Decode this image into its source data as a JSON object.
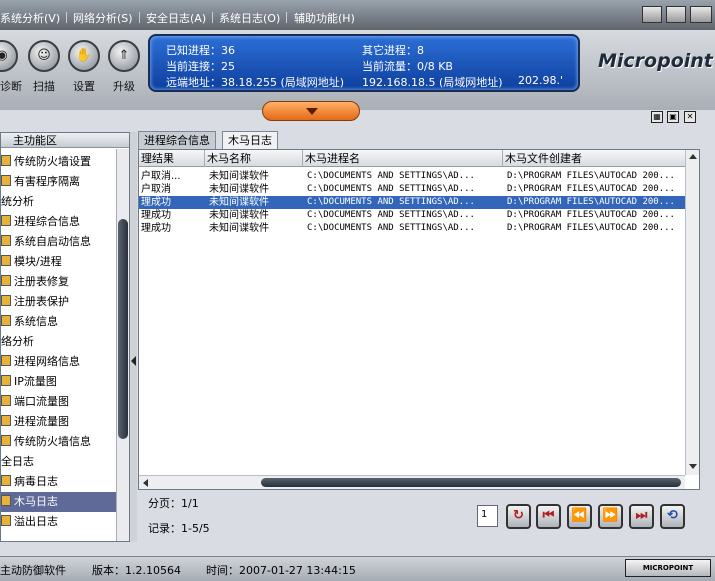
{
  "menu": [
    "系统分析(V)",
    "网络分析(S)",
    "安全日志(A)",
    "系统日志(O)",
    "辅助功能(H)"
  ],
  "toolbar": {
    "buttons": [
      {
        "label": "诊断",
        "icon": "diagnose-icon"
      },
      {
        "label": "扫描",
        "icon": "scan-icon"
      },
      {
        "label": "设置",
        "icon": "settings-icon"
      },
      {
        "label": "升级",
        "icon": "upgrade-icon"
      }
    ]
  },
  "status_panel": {
    "known_processes": "已知进程：36",
    "other_processes": "其它进程：8",
    "current_connections": "当前连接：25",
    "current_traffic": "当前流量：0/8 KB",
    "remote_address": "远端地址：38.18.255 (局域网地址)",
    "local_address": "192.168.18.5 (局域网地址)",
    "extra": "202.98.'"
  },
  "logo": "Micropoint",
  "sidebar": {
    "title": "主功能区",
    "items": [
      {
        "label": "传统防火墙设置",
        "type": "item"
      },
      {
        "label": "有害程序隔离",
        "type": "item"
      },
      {
        "label": "统分析",
        "type": "group"
      },
      {
        "label": "进程综合信息",
        "type": "item"
      },
      {
        "label": "系统自启动信息",
        "type": "item"
      },
      {
        "label": "模块/进程",
        "type": "item"
      },
      {
        "label": "注册表修复",
        "type": "item"
      },
      {
        "label": "注册表保护",
        "type": "item"
      },
      {
        "label": "系统信息",
        "type": "item"
      },
      {
        "label": "络分析",
        "type": "group"
      },
      {
        "label": "进程网络信息",
        "type": "item"
      },
      {
        "label": "IP流量图",
        "type": "item"
      },
      {
        "label": "端口流量图",
        "type": "item"
      },
      {
        "label": "进程流量图",
        "type": "item"
      },
      {
        "label": "传统防火墙信息",
        "type": "item"
      },
      {
        "label": "全日志",
        "type": "group"
      },
      {
        "label": "病毒日志",
        "type": "item"
      },
      {
        "label": "木马日志",
        "type": "item",
        "selected": true
      },
      {
        "label": "溢出日志",
        "type": "item"
      }
    ]
  },
  "tabs": [
    {
      "label": "进程综合信息",
      "active": false
    },
    {
      "label": "木马日志",
      "active": true
    }
  ],
  "table": {
    "columns": [
      "理结果",
      "木马名称",
      "木马进程名",
      "木马文件创建者"
    ],
    "rows": [
      [
        "户取消...",
        "未知间谍软件",
        "C:\\DOCUMENTS AND SETTINGS\\AD...",
        "D:\\PROGRAM FILES\\AUTOCAD 200..."
      ],
      [
        "户取消",
        "未知间谍软件",
        "C:\\DOCUMENTS AND SETTINGS\\AD...",
        "D:\\PROGRAM FILES\\AUTOCAD 200..."
      ],
      [
        "理成功",
        "未知间谍软件",
        "C:\\DOCUMENTS AND SETTINGS\\AD...",
        "D:\\PROGRAM FILES\\AUTOCAD 200..."
      ],
      [
        "理成功",
        "未知间谍软件",
        "C:\\DOCUMENTS AND SETTINGS\\AD...",
        "D:\\PROGRAM FILES\\AUTOCAD 200..."
      ],
      [
        "理成功",
        "未知间谍软件",
        "C:\\DOCUMENTS AND SETTINGS\\AD...",
        "D:\\PROGRAM FILES\\AUTOCAD 200..."
      ]
    ],
    "selected_row": 2
  },
  "pagination": {
    "page": "分页：1/1",
    "records": "记录：1-5/5",
    "page_input": "1"
  },
  "statusbar": {
    "app": "主动防御软件",
    "version": "版本：1.2.10564",
    "time": "时间：2007-01-27 13:44:15",
    "brand": "MICROPOINT"
  },
  "colors": {
    "accent": "#1f55c0",
    "selection": "#3366b8",
    "sidebar_selection": "#5f6a99",
    "handle": "#e46a17"
  }
}
